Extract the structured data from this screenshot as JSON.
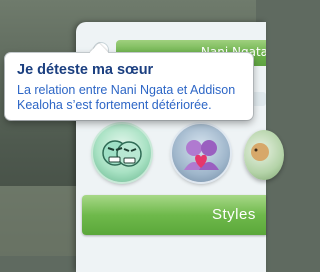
{
  "panel": {
    "sim_name_partial": "Nani Ngata",
    "styles_button_label": "Styles"
  },
  "tooltip": {
    "title": "Je déteste ma sœur",
    "body": "La relation entre Nani Ngata et Addison Kealoha s’est fortement détériorée."
  },
  "traits": [
    {
      "icon": "angry-faces-icon",
      "state": "selected"
    },
    {
      "icon": "two-sims-heart-icon",
      "state": "normal"
    },
    {
      "icon": "trait-icon",
      "state": "partially-visible"
    }
  ],
  "colors": {
    "tooltip_title": "#1b3f80",
    "tooltip_body": "#2d66c6",
    "green_button": "#6fb94b"
  }
}
